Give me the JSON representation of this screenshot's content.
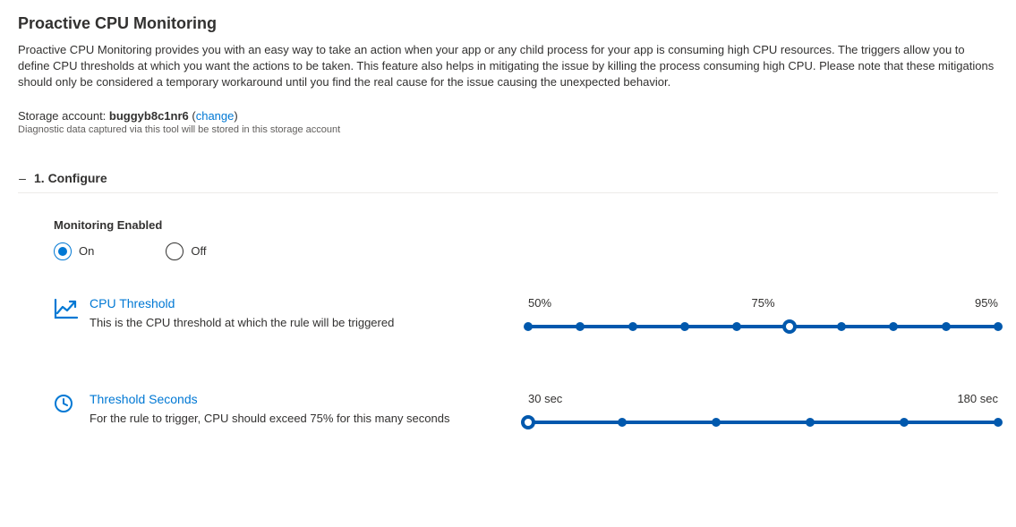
{
  "page": {
    "title": "Proactive CPU Monitoring",
    "description": "Proactive CPU Monitoring provides you with an easy way to take an action when your app or any child process for your app is consuming high CPU resources. The triggers allow you to define CPU thresholds at which you want the actions to be taken. This feature also helps in mitigating the issue by killing the process consuming high CPU. Please note that these mitigations should only be considered a temporary workaround until you find the real cause for the issue causing the unexpected behavior."
  },
  "storage": {
    "label": "Storage account: ",
    "account": "buggyb8c1nr6",
    "change_open": " (",
    "change": "change",
    "change_close": ")",
    "note": "Diagnostic data captured via this tool will be stored in this storage account"
  },
  "section": {
    "collapse_icon": "–",
    "title": "1. Configure"
  },
  "monitoring": {
    "label": "Monitoring Enabled",
    "options": {
      "on": "On",
      "off": "Off"
    },
    "selected": "on"
  },
  "cpu_threshold": {
    "title": "CPU Threshold",
    "desc": "This is the CPU threshold at which the rule will be triggered",
    "min_label": "50%",
    "mid_label": "75%",
    "max_label": "95%",
    "min": 50,
    "max": 95,
    "value": 75,
    "ticks": [
      50,
      55,
      60,
      65,
      70,
      75,
      80,
      85,
      90,
      95
    ]
  },
  "threshold_seconds": {
    "title": "Threshold Seconds",
    "desc": "For the rule to trigger, CPU should exceed 75% for this many seconds",
    "min_label": "30 sec",
    "max_label": "180 sec",
    "min": 30,
    "max": 180,
    "value": 30,
    "ticks": [
      30,
      60,
      90,
      120,
      150,
      180
    ]
  }
}
